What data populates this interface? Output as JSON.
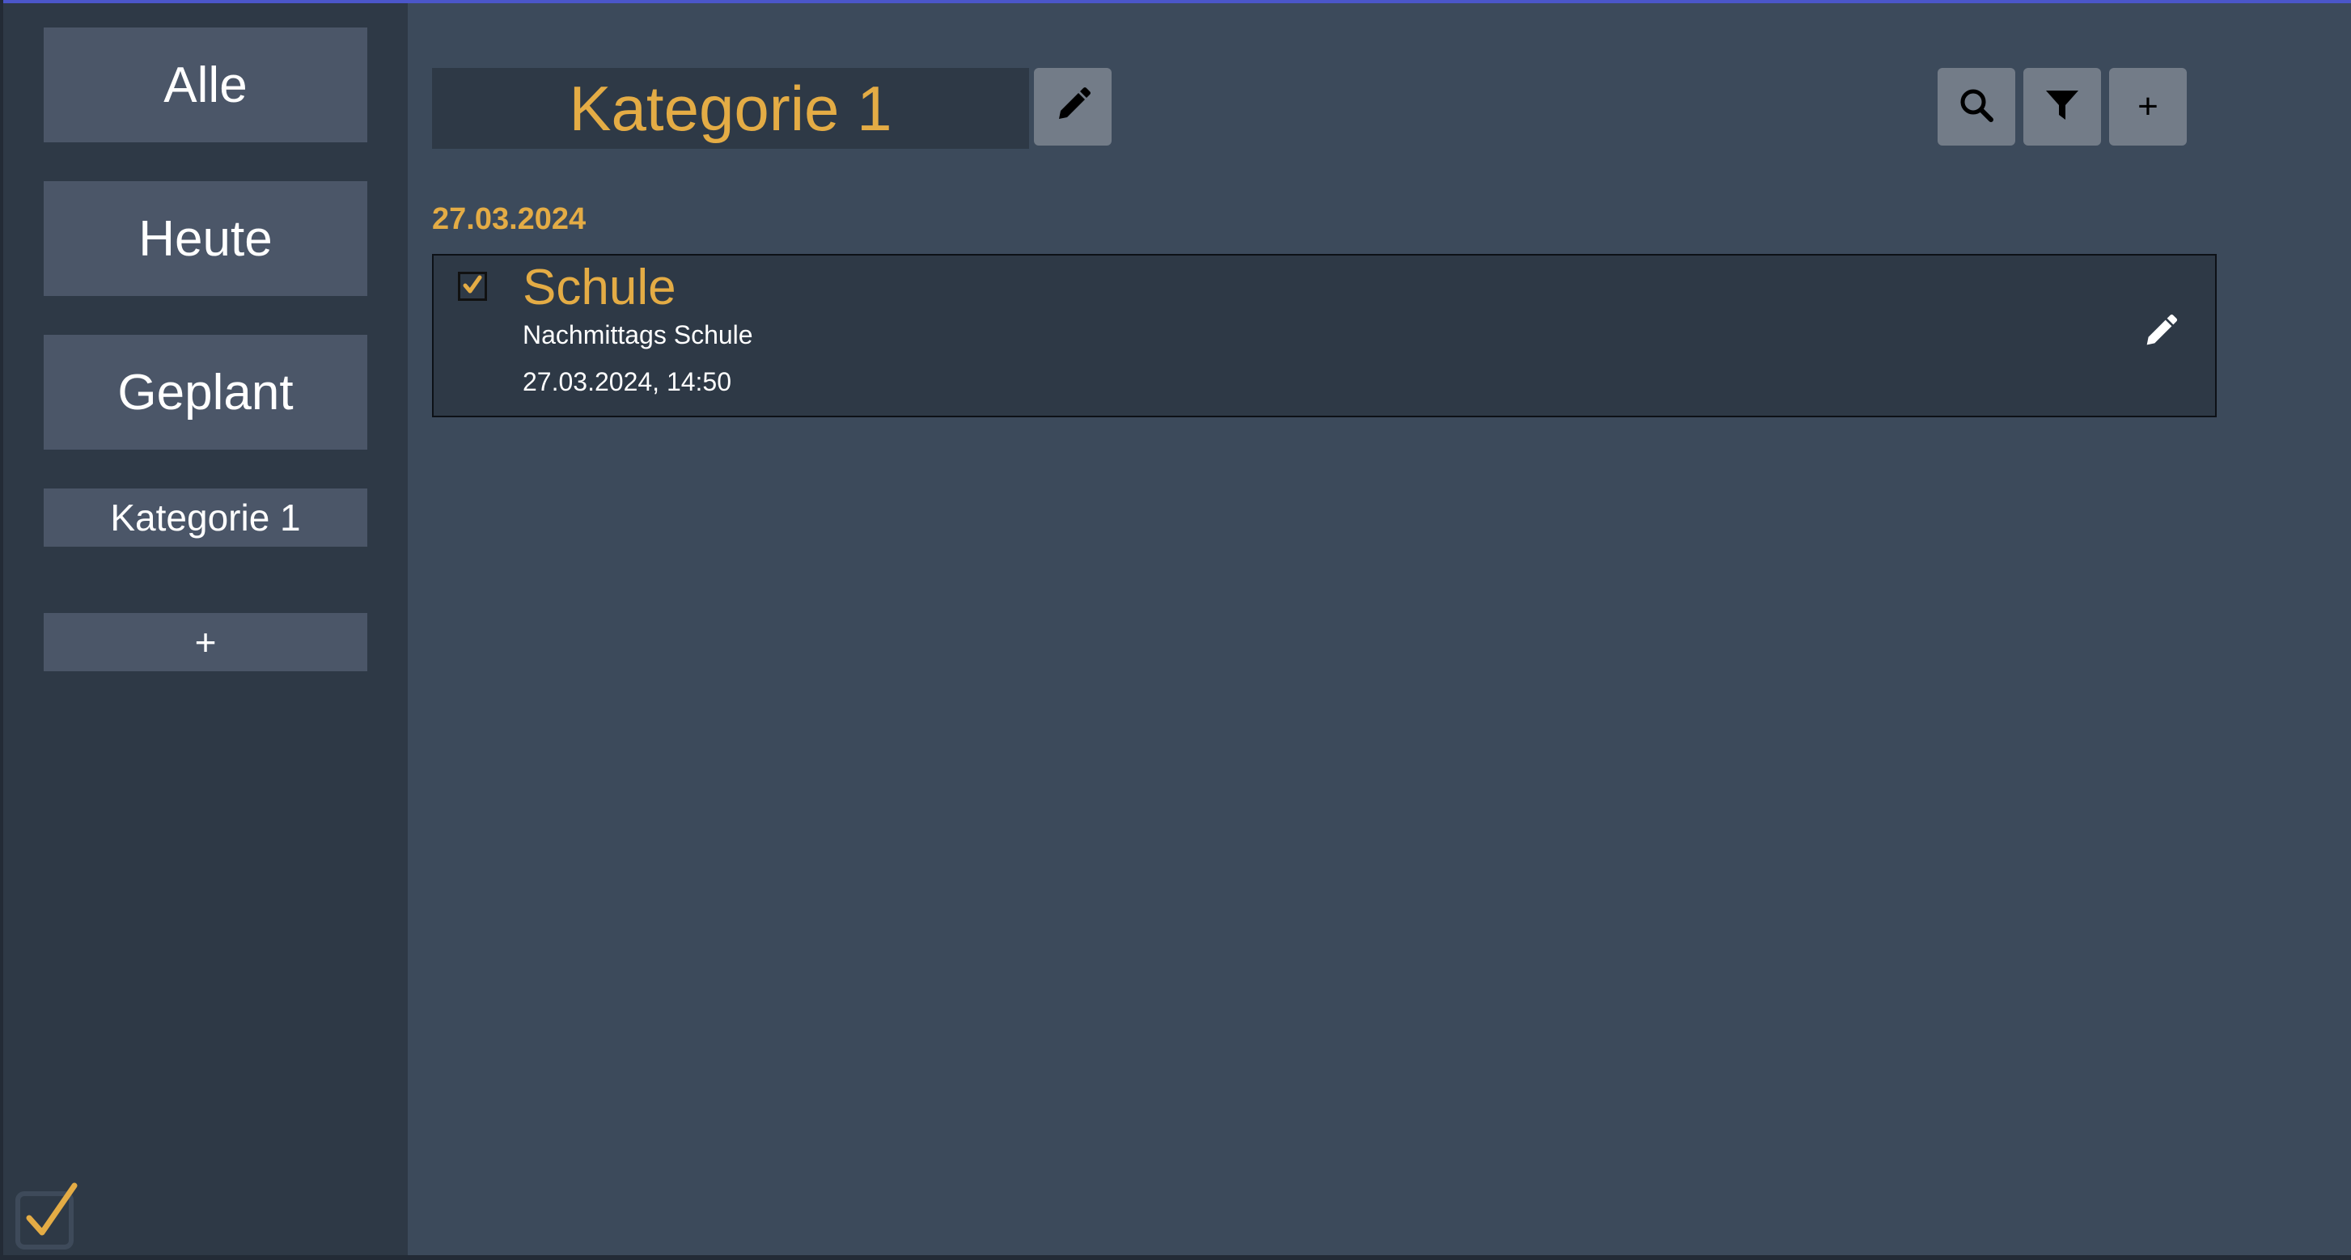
{
  "sidebar": {
    "items": [
      {
        "label": "Alle"
      },
      {
        "label": "Heute"
      },
      {
        "label": "Geplant"
      },
      {
        "label": "Kategorie 1"
      }
    ],
    "add_label": "+"
  },
  "header": {
    "title": "Kategorie 1",
    "add_label": "+"
  },
  "groups": [
    {
      "date": "27.03.2024",
      "tasks": [
        {
          "title": "Schule",
          "description": "Nachmittags Schule",
          "due": "27.03.2024, 14:50",
          "done": true
        }
      ]
    }
  ],
  "colors": {
    "accent": "#e4ac45",
    "background": "#3c4a5b",
    "sidebar": "#2e3946",
    "nav_button": "#4b5668",
    "icon_button": "#737c88"
  }
}
